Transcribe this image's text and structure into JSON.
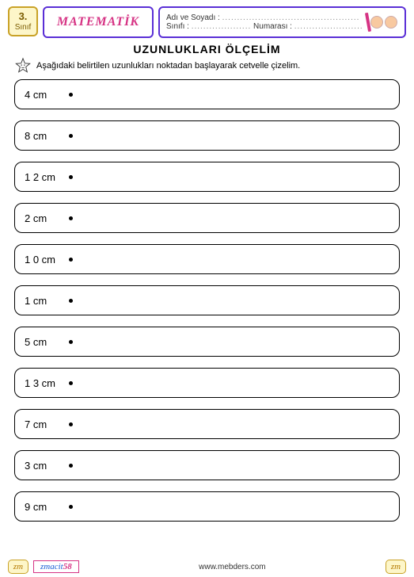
{
  "header": {
    "grade_num": "3.",
    "grade_label": "Sınıf",
    "subject": "MATEMATİK",
    "name_label": "Adı ve Soyadı :",
    "class_label": "Sınıfı :",
    "number_label": "Numarası :",
    "dots1": "..............................................",
    "dots2": "....................",
    "dots3": "......................."
  },
  "title": "UZUNLUKLARI  ÖLÇELİM",
  "instruction": "Aşağıdaki belirtilen uzunlukları noktadan başlayarak cetvelle çizelim.",
  "items": [
    {
      "label": "4 cm"
    },
    {
      "label": "8 cm"
    },
    {
      "label": "1 2 cm"
    },
    {
      "label": "2 cm"
    },
    {
      "label": "1 0 cm"
    },
    {
      "label": "1 cm"
    },
    {
      "label": "5 cm"
    },
    {
      "label": "1 3 cm"
    },
    {
      "label": "7 cm"
    },
    {
      "label": "3 cm"
    },
    {
      "label": "9 cm"
    }
  ],
  "footer": {
    "corner": "zm",
    "author_name": "zmacit",
    "author_num": "58",
    "site": "www.mebders.com"
  }
}
